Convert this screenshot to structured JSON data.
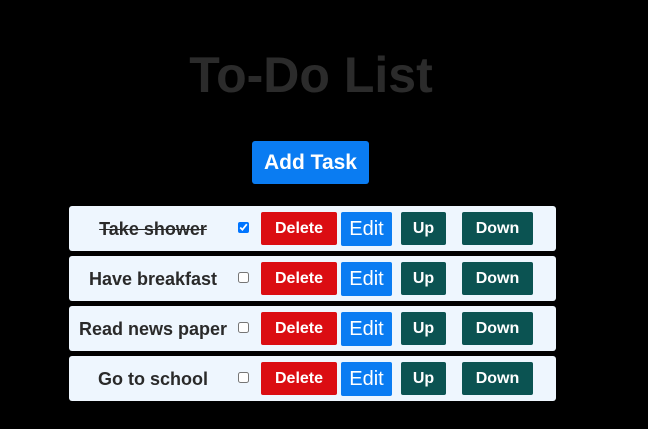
{
  "header": {
    "title": "To-Do List"
  },
  "toolbar": {
    "add_task_label": "Add Task"
  },
  "buttons": {
    "delete_label": "Delete",
    "edit_label": "Edit",
    "up_label": "Up",
    "down_label": "Down"
  },
  "tasks": [
    {
      "text": "Take shower",
      "completed": true
    },
    {
      "text": "Have breakfast",
      "completed": false
    },
    {
      "text": "Read news paper",
      "completed": false
    },
    {
      "text": "Go to school",
      "completed": false
    }
  ],
  "colors": {
    "background": "#000000",
    "title": "#2b2b2b",
    "primary": "#0a7cf2",
    "danger": "#db0d12",
    "move": "#0b5352",
    "task_row": "#eef6fe"
  }
}
